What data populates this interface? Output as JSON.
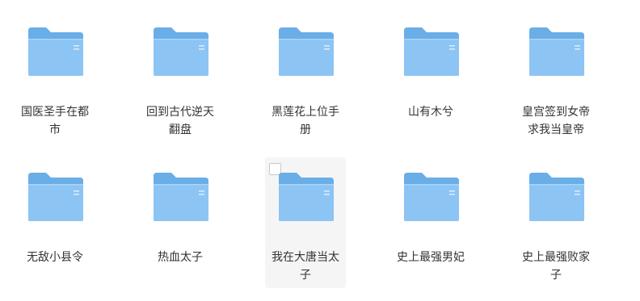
{
  "folders": [
    {
      "name": "国医圣手在都市"
    },
    {
      "name": "回到古代逆天翻盘"
    },
    {
      "name": "黑莲花上位手册"
    },
    {
      "name": "山有木兮"
    },
    {
      "name": "皇宫签到女帝求我当皇帝"
    },
    {
      "name": "无敌小县令"
    },
    {
      "name": "热血太子"
    },
    {
      "name": "我在大唐当太子",
      "hovered": true,
      "checked": false
    },
    {
      "name": "史上最强男妃"
    },
    {
      "name": "史上最强败家子"
    }
  ],
  "colors": {
    "folder_back": "#6aaee8",
    "folder_front_top": "#8fc6f5",
    "folder_front_bottom": "#7bb8ef",
    "hover_bg": "#f5f5f6",
    "text": "#333333"
  },
  "icon": "folder-icon"
}
